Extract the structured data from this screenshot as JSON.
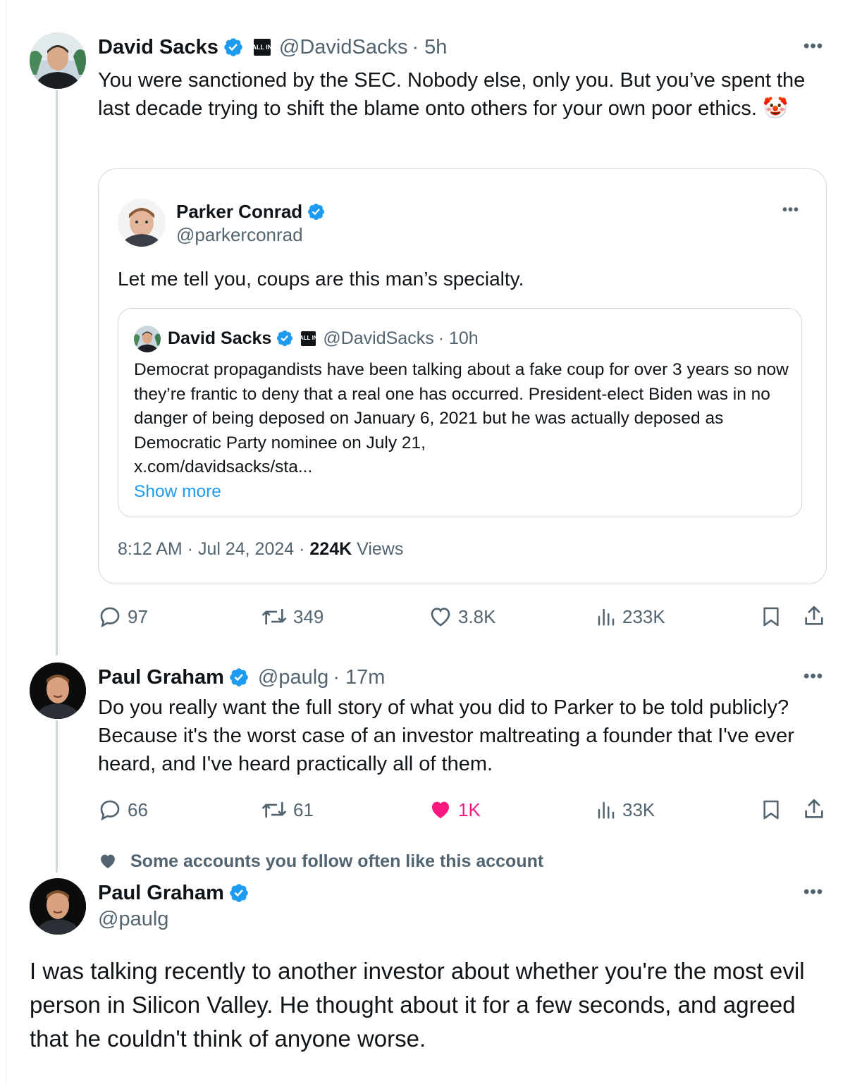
{
  "tweet1": {
    "name": "David Sacks",
    "badge": "ALL IN",
    "handle": "@DavidSacks",
    "time": "· 5h",
    "text": "You were sanctioned by the SEC. Nobody else, only you. But you’ve spent the last decade trying to shift the blame onto others for your own poor ethics.",
    "emoji": "🤡",
    "quote": {
      "name": "Parker Conrad",
      "handle": "@parkerconrad",
      "text": "Let me tell you, coups are this man’s specialty.",
      "nested": {
        "name": "David Sacks",
        "badge": "ALL IN",
        "handle": "@DavidSacks",
        "time": "· 10h",
        "text": "Democrat propagandists have been talking about a fake coup for over 3 years so now they’re frantic to deny that a real one has occurred. President-elect Biden was in no danger of being deposed on January 6, 2021 but he was actually deposed as Democratic Party nominee on July 21,",
        "link": "x.com/davidsacks/sta...",
        "show_more": "Show more"
      },
      "timestamp": "8:12 AM · Jul 24, 2024 · ",
      "views_count": "224K",
      "views_label": " Views"
    },
    "actions": {
      "replies": "97",
      "reposts": "349",
      "likes": "3.8K",
      "views": "233K"
    }
  },
  "tweet2": {
    "name": "Paul Graham",
    "handle": "@paulg",
    "time": "· 17m",
    "text": "Do you really want the full story of what you did to Parker to be told publicly? Because it's the worst case of an investor maltreating a founder that I've ever heard, and I've heard practically all of them.",
    "actions": {
      "replies": "66",
      "reposts": "61",
      "likes": "1K",
      "views": "33K"
    },
    "liked": true
  },
  "social_context": "Some accounts you follow often like this account",
  "tweet3": {
    "name": "Paul Graham",
    "handle": "@paulg",
    "text": "I was talking recently to another investor about whether you're the most evil person in Silicon Valley. He thought about it for a few seconds, and agreed that he couldn't think of anyone worse."
  },
  "colors": {
    "verified": "#1d9bf0",
    "like": "#f91880",
    "secondary": "#536471",
    "link": "#1d9bf0"
  }
}
